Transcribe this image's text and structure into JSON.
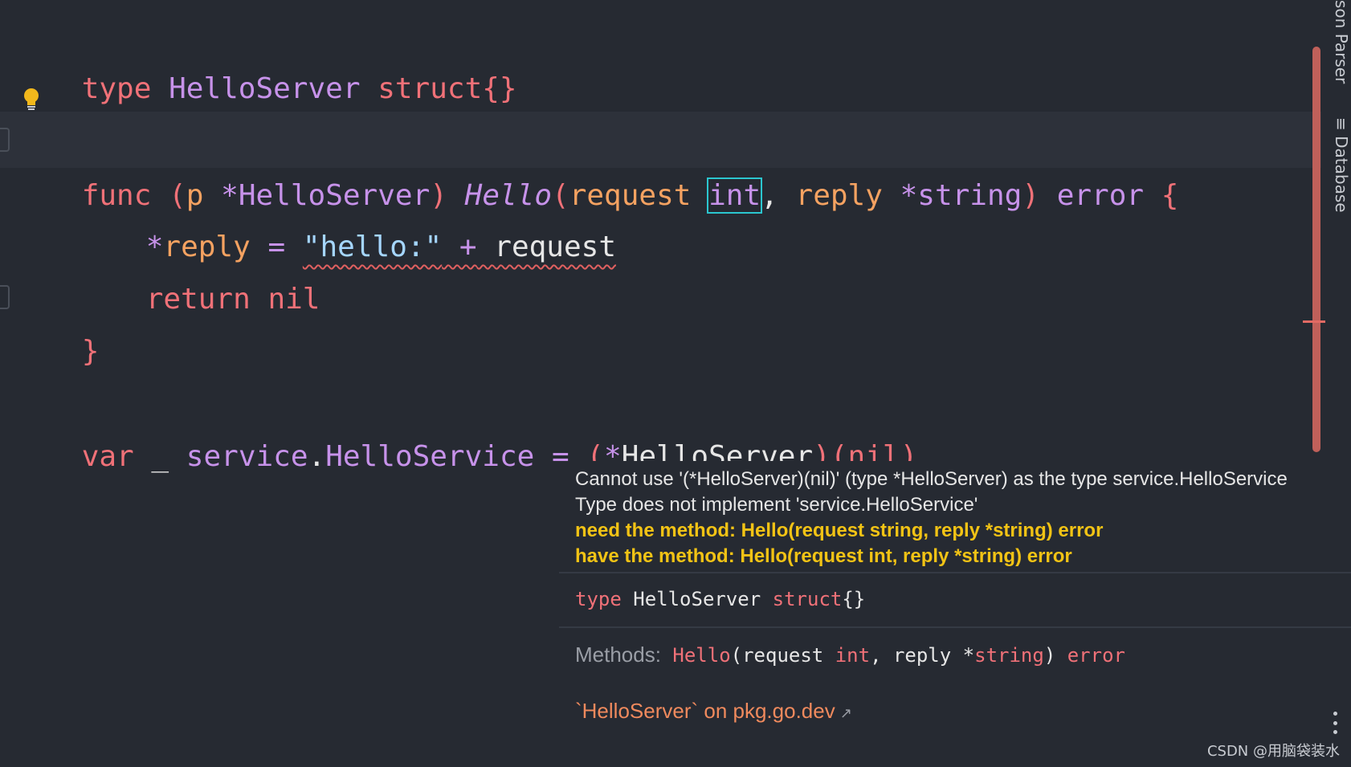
{
  "editor": {
    "line1": {
      "kw": "type",
      "name": "HelloServer",
      "tail": "struct{}"
    },
    "line2": {
      "func": "func",
      "recv_open": "(",
      "recv_name": "p",
      "recv_star": "*",
      "recv_type": "HelloServer",
      "recv_close": ")",
      "method": "Hello",
      "paren_open": "(",
      "param1": "request",
      "param1_type": "int",
      "comma": ",",
      "param2": "reply",
      "star": "*",
      "param2_type": "string",
      "paren_close": ")",
      "ret": "error",
      "brace": "{"
    },
    "line3": {
      "star": "*",
      "lhs": "reply",
      "eq": "=",
      "str": "\"hello:\"",
      "plus": "+",
      "rhs": "request"
    },
    "line4": {
      "ret": "return",
      "nil": "nil"
    },
    "line5": {
      "brace": "}"
    },
    "line6": {
      "var": "var",
      "blank": "_",
      "pkg": "service",
      "dot": ".",
      "iface": "HelloService",
      "eq": "=",
      "open": "(",
      "star": "*",
      "type": "HelloServer",
      "close": ")",
      "arg_open": "(",
      "nil": "nil",
      "arg_close": ")"
    }
  },
  "side_tabs": {
    "json_parser": "son Parser",
    "database": "Database"
  },
  "popup": {
    "line1": "Cannot use '(*HelloServer)(nil)' (type *HelloServer) as the type service.HelloService",
    "line2": "Type does not implement 'service.HelloService'",
    "line3": "need the method: Hello(request string, reply *string) error",
    "line4": "have the method: Hello(request int, reply *string) error",
    "decl": {
      "kw": "type",
      "name": "HelloServer",
      "tail": "struct",
      "braces": "{}"
    },
    "methods": {
      "label": "Methods:",
      "name": "Hello",
      "open": "(request",
      "int": "int",
      "mid": ", reply",
      "star": "*",
      "string": "string",
      "close": ")",
      "ret": "error"
    },
    "link": "`HelloServer` on pkg.go.dev"
  },
  "watermark": "CSDN @用脑袋装水"
}
